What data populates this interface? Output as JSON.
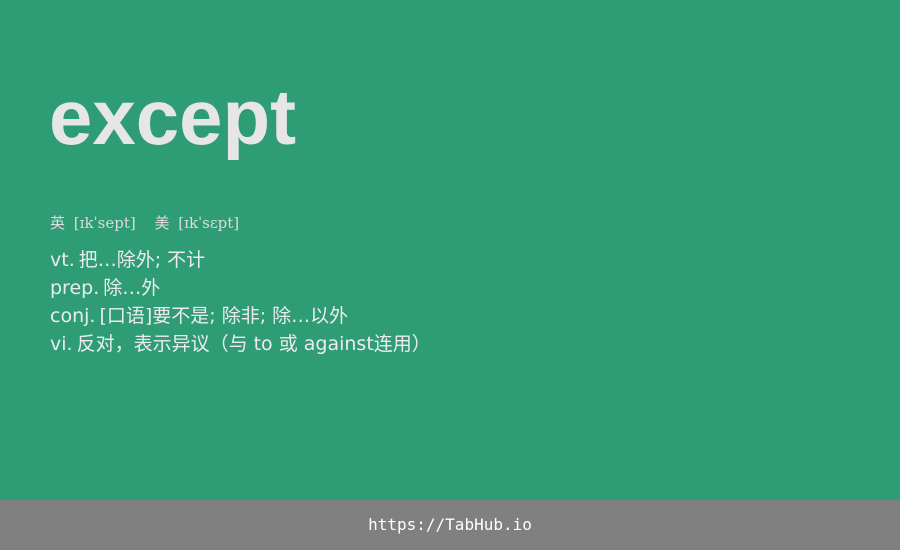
{
  "card": {
    "word": "except",
    "phonetics": [
      {
        "lang": "英",
        "ipa": "[ɪkˈsept]"
      },
      {
        "lang": "美",
        "ipa": "[ɪkˈsɛpt]"
      }
    ],
    "definitions": [
      {
        "pos": "vt.",
        "meaning": "把…除外; 不计"
      },
      {
        "pos": "prep.",
        "meaning": "除…外"
      },
      {
        "pos": "conj.",
        "meaning": "[口语]要不是; 除非; 除…以外"
      },
      {
        "pos": "vi.",
        "meaning": "反对，表示异议（与 to 或 against连用）"
      }
    ]
  },
  "footer": {
    "link_text": "https://TabHub.io"
  },
  "colors": {
    "background": "#2e9c74",
    "footer": "#808080",
    "word": "#e6e6e6",
    "text": "#ececec"
  }
}
